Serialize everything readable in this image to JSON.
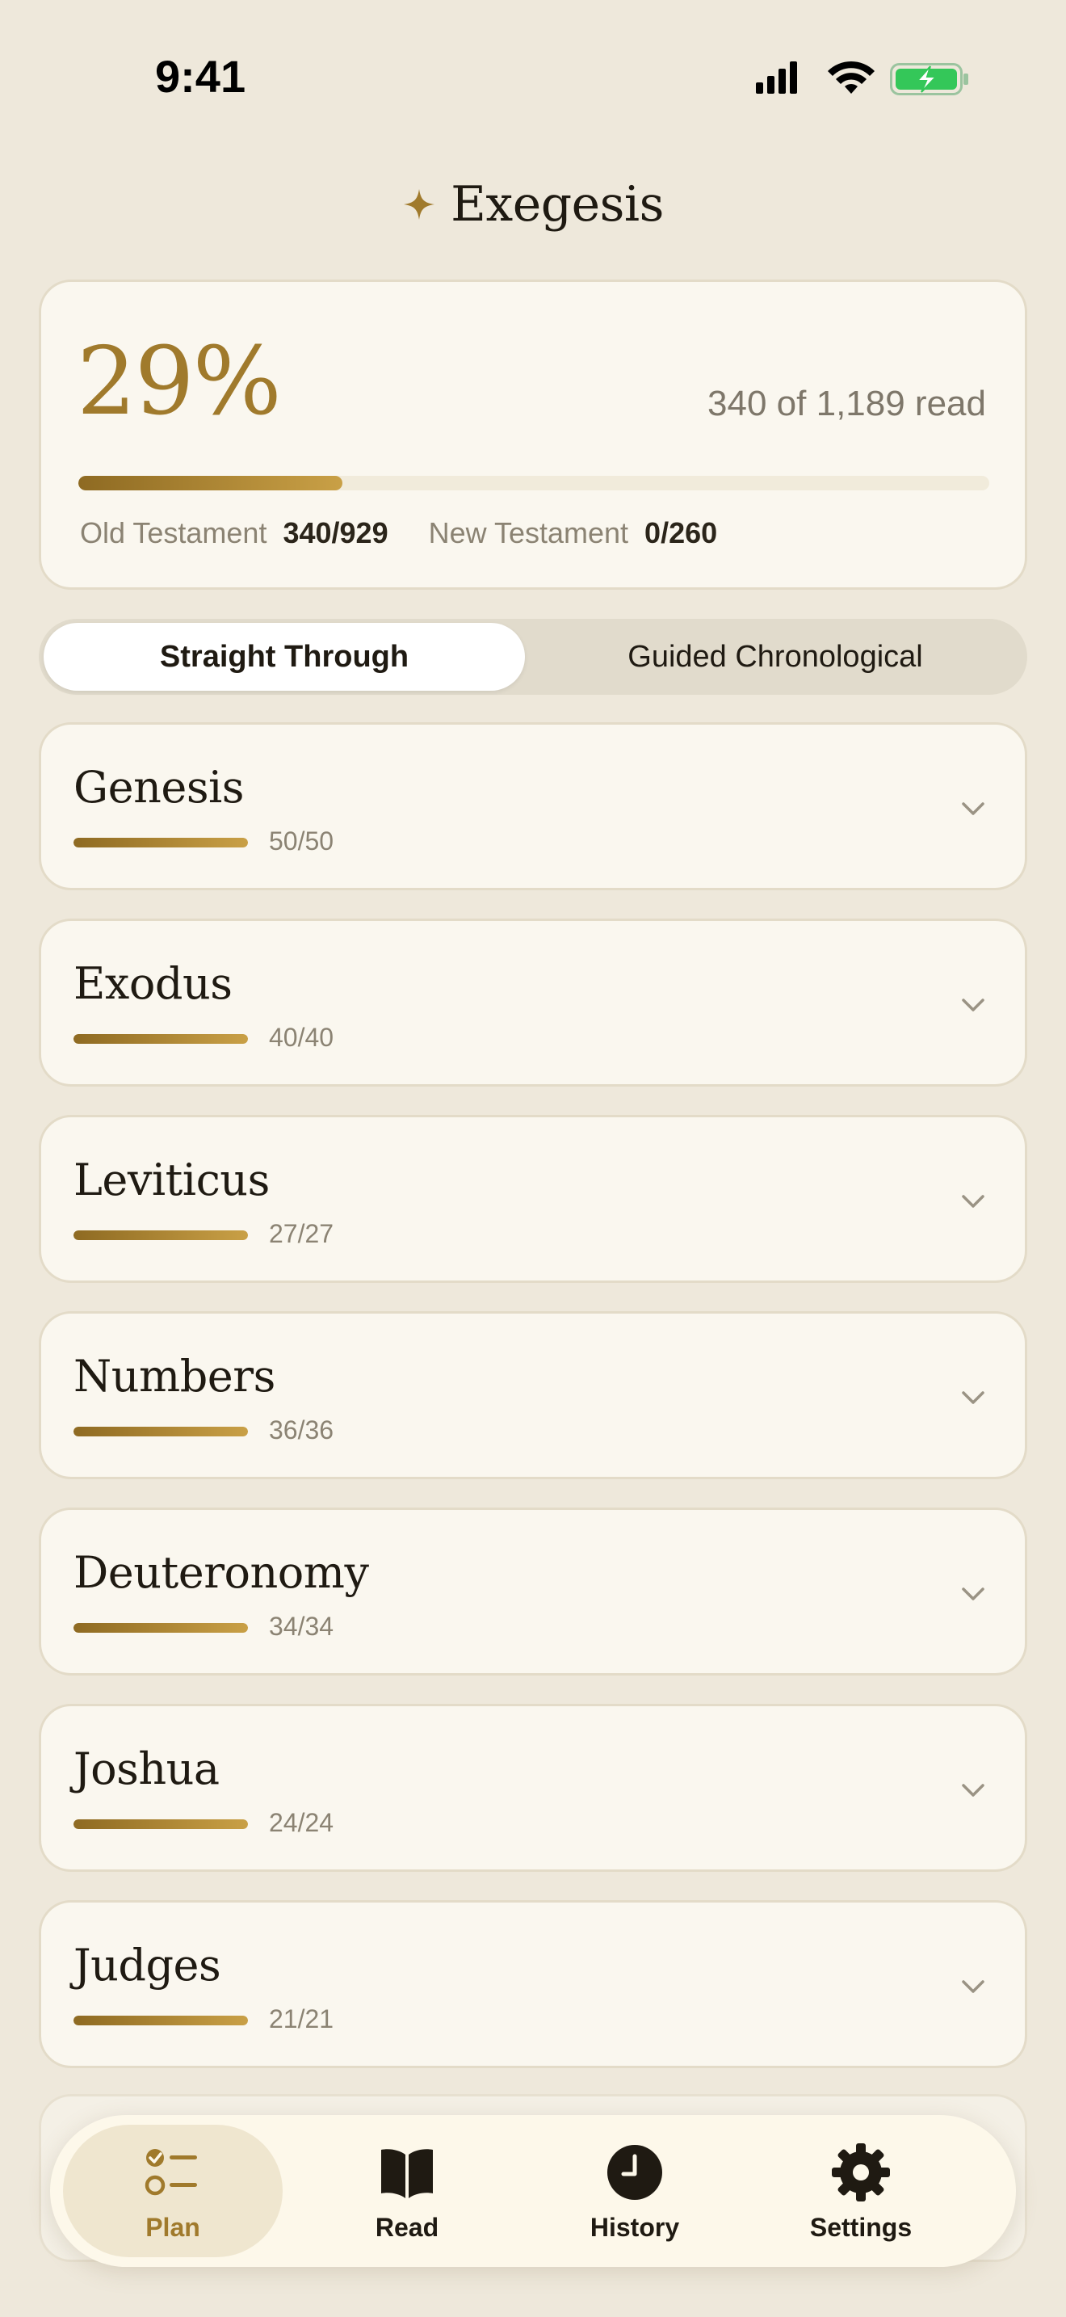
{
  "status_bar": {
    "time": "9:41"
  },
  "header": {
    "title": "Exegesis",
    "icon": "sparkle-icon"
  },
  "summary": {
    "percent_text": "29%",
    "read_text": "340 of 1,189 read",
    "progress": 0.29,
    "old_testament_label": "Old Testament",
    "old_testament_count": "340/929",
    "new_testament_label": "New Testament",
    "new_testament_count": "0/260"
  },
  "plan_modes": [
    {
      "label": "Straight Through",
      "selected": true
    },
    {
      "label": "Guided Chronological",
      "selected": false
    }
  ],
  "books": [
    {
      "name": "Genesis",
      "count": "50/50",
      "progress": 1.0
    },
    {
      "name": "Exodus",
      "count": "40/40",
      "progress": 1.0
    },
    {
      "name": "Leviticus",
      "count": "27/27",
      "progress": 1.0
    },
    {
      "name": "Numbers",
      "count": "36/36",
      "progress": 1.0
    },
    {
      "name": "Deuteronomy",
      "count": "34/34",
      "progress": 1.0
    },
    {
      "name": "Joshua",
      "count": "24/24",
      "progress": 1.0
    },
    {
      "name": "Judges",
      "count": "21/21",
      "progress": 1.0
    }
  ],
  "tab_bar": {
    "tabs": [
      {
        "label": "Plan",
        "icon": "checklist-icon",
        "active": true
      },
      {
        "label": "Read",
        "icon": "book-icon",
        "active": false
      },
      {
        "label": "History",
        "icon": "clock-icon",
        "active": false
      },
      {
        "label": "Settings",
        "icon": "gear-icon",
        "active": false
      }
    ]
  },
  "colors": {
    "accent": "#A07A2C",
    "background": "#EEE8DB",
    "card": "#FAF7EF",
    "battery": "#34C759"
  }
}
